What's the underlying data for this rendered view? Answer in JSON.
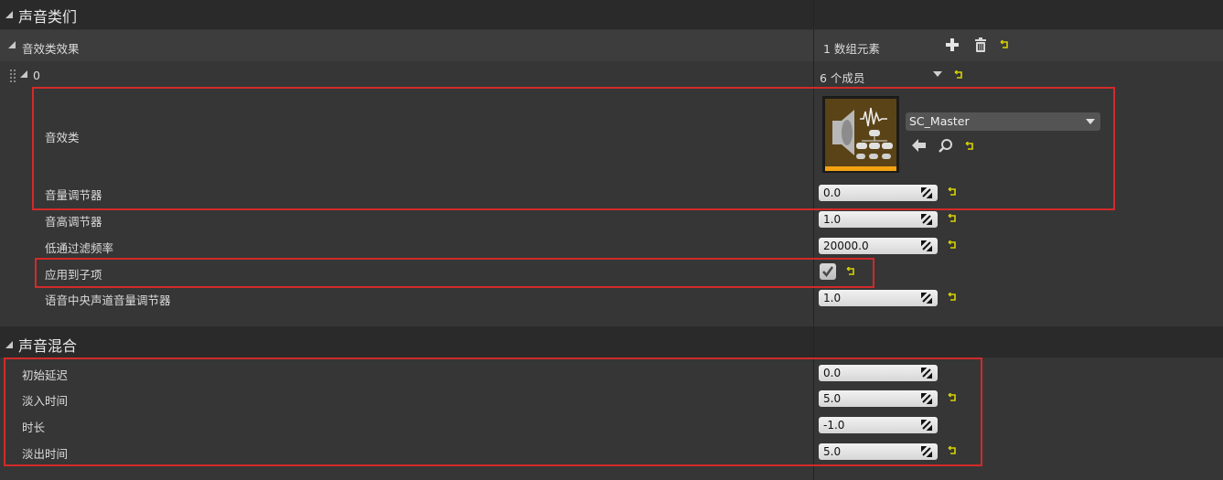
{
  "sections": {
    "sound_class": {
      "title": "声音类们"
    },
    "sound_mix": {
      "title": "声音混合"
    }
  },
  "effects": {
    "label": "音效类效果",
    "count": "1 数组元素",
    "index": "0",
    "members": "6 个成员"
  },
  "sound_class_prop": {
    "label": "音效类",
    "asset": "SC_Master"
  },
  "props": {
    "volume": {
      "label": "音量调节器",
      "value": "0.0"
    },
    "pitch": {
      "label": "音高调节器",
      "value": "1.0"
    },
    "lowpass": {
      "label": "低通过滤频率",
      "value": "20000.0"
    },
    "apply_children": {
      "label": "应用到子项",
      "checked": true
    },
    "center": {
      "label": "语音中央声道音量调节器",
      "value": "1.0"
    }
  },
  "mix": {
    "initial_delay": {
      "label": "初始延迟",
      "value": "0.0"
    },
    "fade_in": {
      "label": "淡入时间",
      "value": "5.0"
    },
    "duration": {
      "label": "时长",
      "value": "-1.0"
    },
    "fade_out": {
      "label": "淡出时间",
      "value": "5.0"
    }
  },
  "colors": {
    "highlight": "#d22a2a",
    "reset_arrow": "#d8d400",
    "thumbnail_accent": "#f3a312"
  }
}
